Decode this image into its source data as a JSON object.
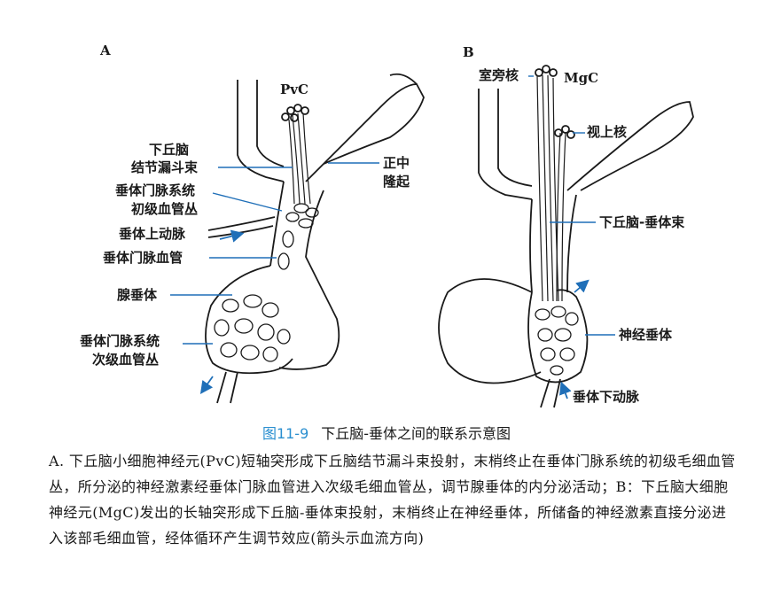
{
  "panels": {
    "a": "A",
    "b": "B"
  },
  "labels_a": {
    "pvc": "PvC",
    "infundibulum_l1": "下丘脑",
    "infundibulum_l2": "结节漏斗束",
    "eminence_l1": "正中",
    "eminence_l2": "隆起",
    "primary_l1": "垂体门脉系统",
    "primary_l2": "初级血管丛",
    "sup_artery": "垂体上动脉",
    "portal_vessel": "垂体门脉血管",
    "adeno": "腺垂体",
    "secondary_l1": "垂体门脉系统",
    "secondary_l2": "次级血管丛"
  },
  "labels_b": {
    "paraventricular": "室旁核",
    "mgc": "MgC",
    "supraoptic": "视上核",
    "tract": "下丘脑-垂体束",
    "neuro": "神经垂体",
    "inf_artery": "垂体下动脉"
  },
  "caption": {
    "figure_number": "图11-9",
    "title": "下丘脑-垂体之间的联系示意图",
    "body": "A. 下丘脑小细胞神经元(PvC)短轴突形成下丘脑结节漏斗束投射，末梢终止在垂体门脉系统的初级毛细血管丛，所分泌的神经激素经垂体门脉血管进入次级毛细血管丛，调节腺垂体的内分泌活动；B：下丘脑大细胞神经元(MgC)发出的长轴突形成下丘脑-垂体束投射，末梢终止在神经垂体，所储备的神经激素直接分泌进入该部毛细血管，经体循环产生调节效应(箭头示血流方向)"
  },
  "colors": {
    "leader": "#1f6fb8",
    "figure_number": "#2a8fd0",
    "ink": "#1a1a1a"
  }
}
